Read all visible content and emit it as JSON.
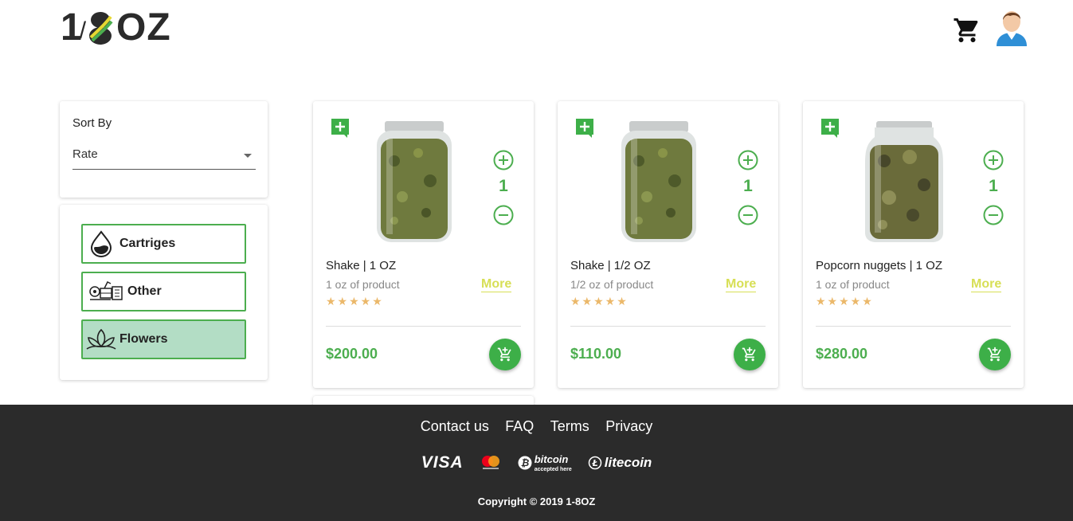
{
  "header": {
    "logo_parts": [
      "1",
      "/",
      "OZ"
    ],
    "colors": {
      "brand_green": "#4cae4f"
    }
  },
  "sort": {
    "label": "Sort By",
    "value": "Rate"
  },
  "categories": [
    {
      "label": "Cartriges",
      "icon": "drop-icon",
      "active": false
    },
    {
      "label": "Other",
      "icon": "accessories-icon",
      "active": false
    },
    {
      "label": "Flowers",
      "icon": "lotus-icon",
      "active": true
    }
  ],
  "products": [
    {
      "name": "Shake | 1 OZ",
      "desc": "1 oz of product",
      "more": "More",
      "stars": "★★★★★",
      "qty": "1",
      "price": "$200.00"
    },
    {
      "name": "Shake | 1/2 OZ",
      "desc": "1/2 oz of product",
      "more": "More",
      "stars": "★★★★★",
      "qty": "1",
      "price": "$110.00"
    },
    {
      "name": "Popcorn nuggets | 1 OZ",
      "desc": "1 oz of product",
      "more": "More",
      "stars": "★★★★★",
      "qty": "1",
      "price": "$280.00"
    }
  ],
  "footer": {
    "links": [
      "Contact us",
      "FAQ",
      "Terms",
      "Privacy"
    ],
    "payments": {
      "visa": "VISA",
      "bitcoin": "bitcoin",
      "bitcoin_sub": "accepted here",
      "litecoin": "litecoin"
    },
    "copyright": "Copyright © 2019 1-8OZ"
  }
}
